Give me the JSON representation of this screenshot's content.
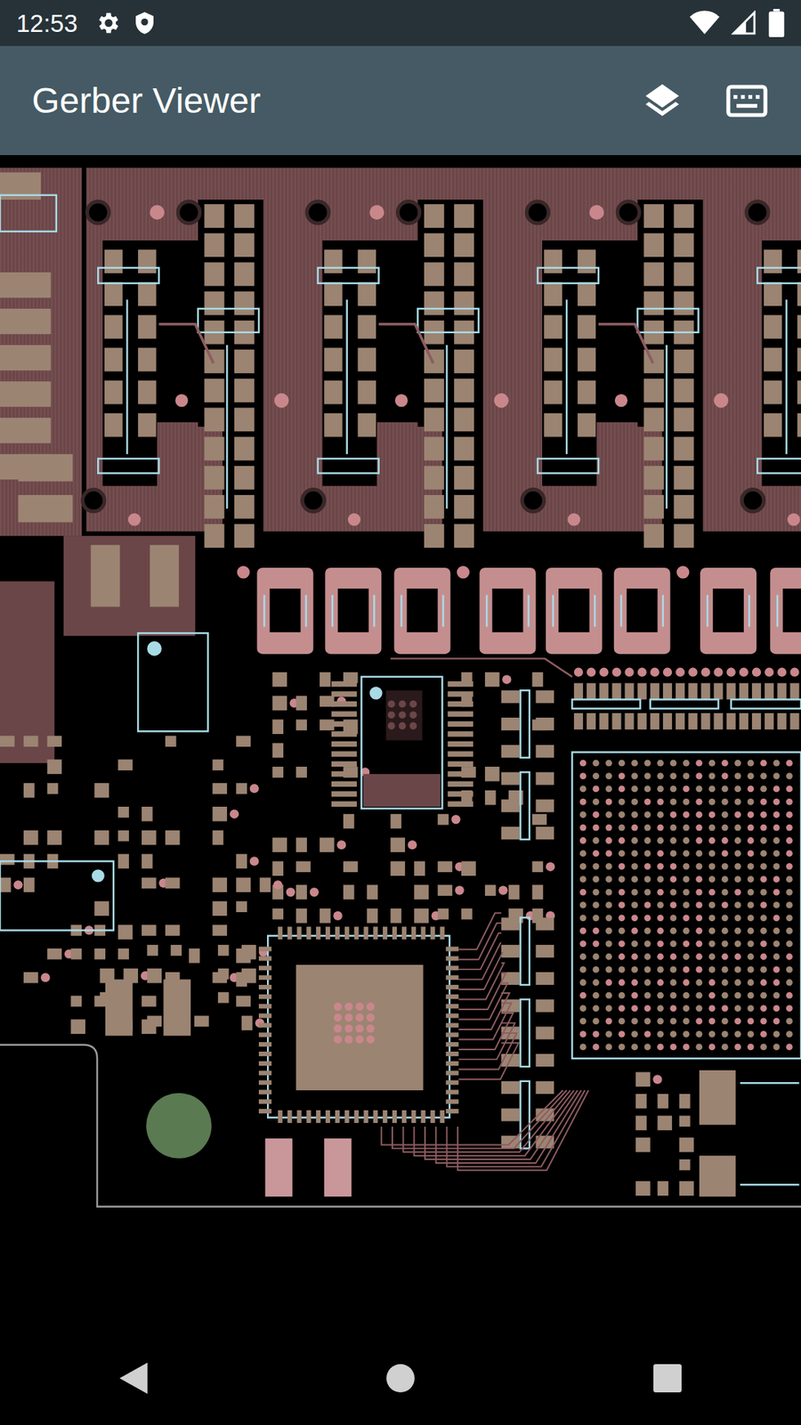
{
  "status_bar": {
    "time": "12:53"
  },
  "app_bar": {
    "title": "Gerber Viewer"
  }
}
